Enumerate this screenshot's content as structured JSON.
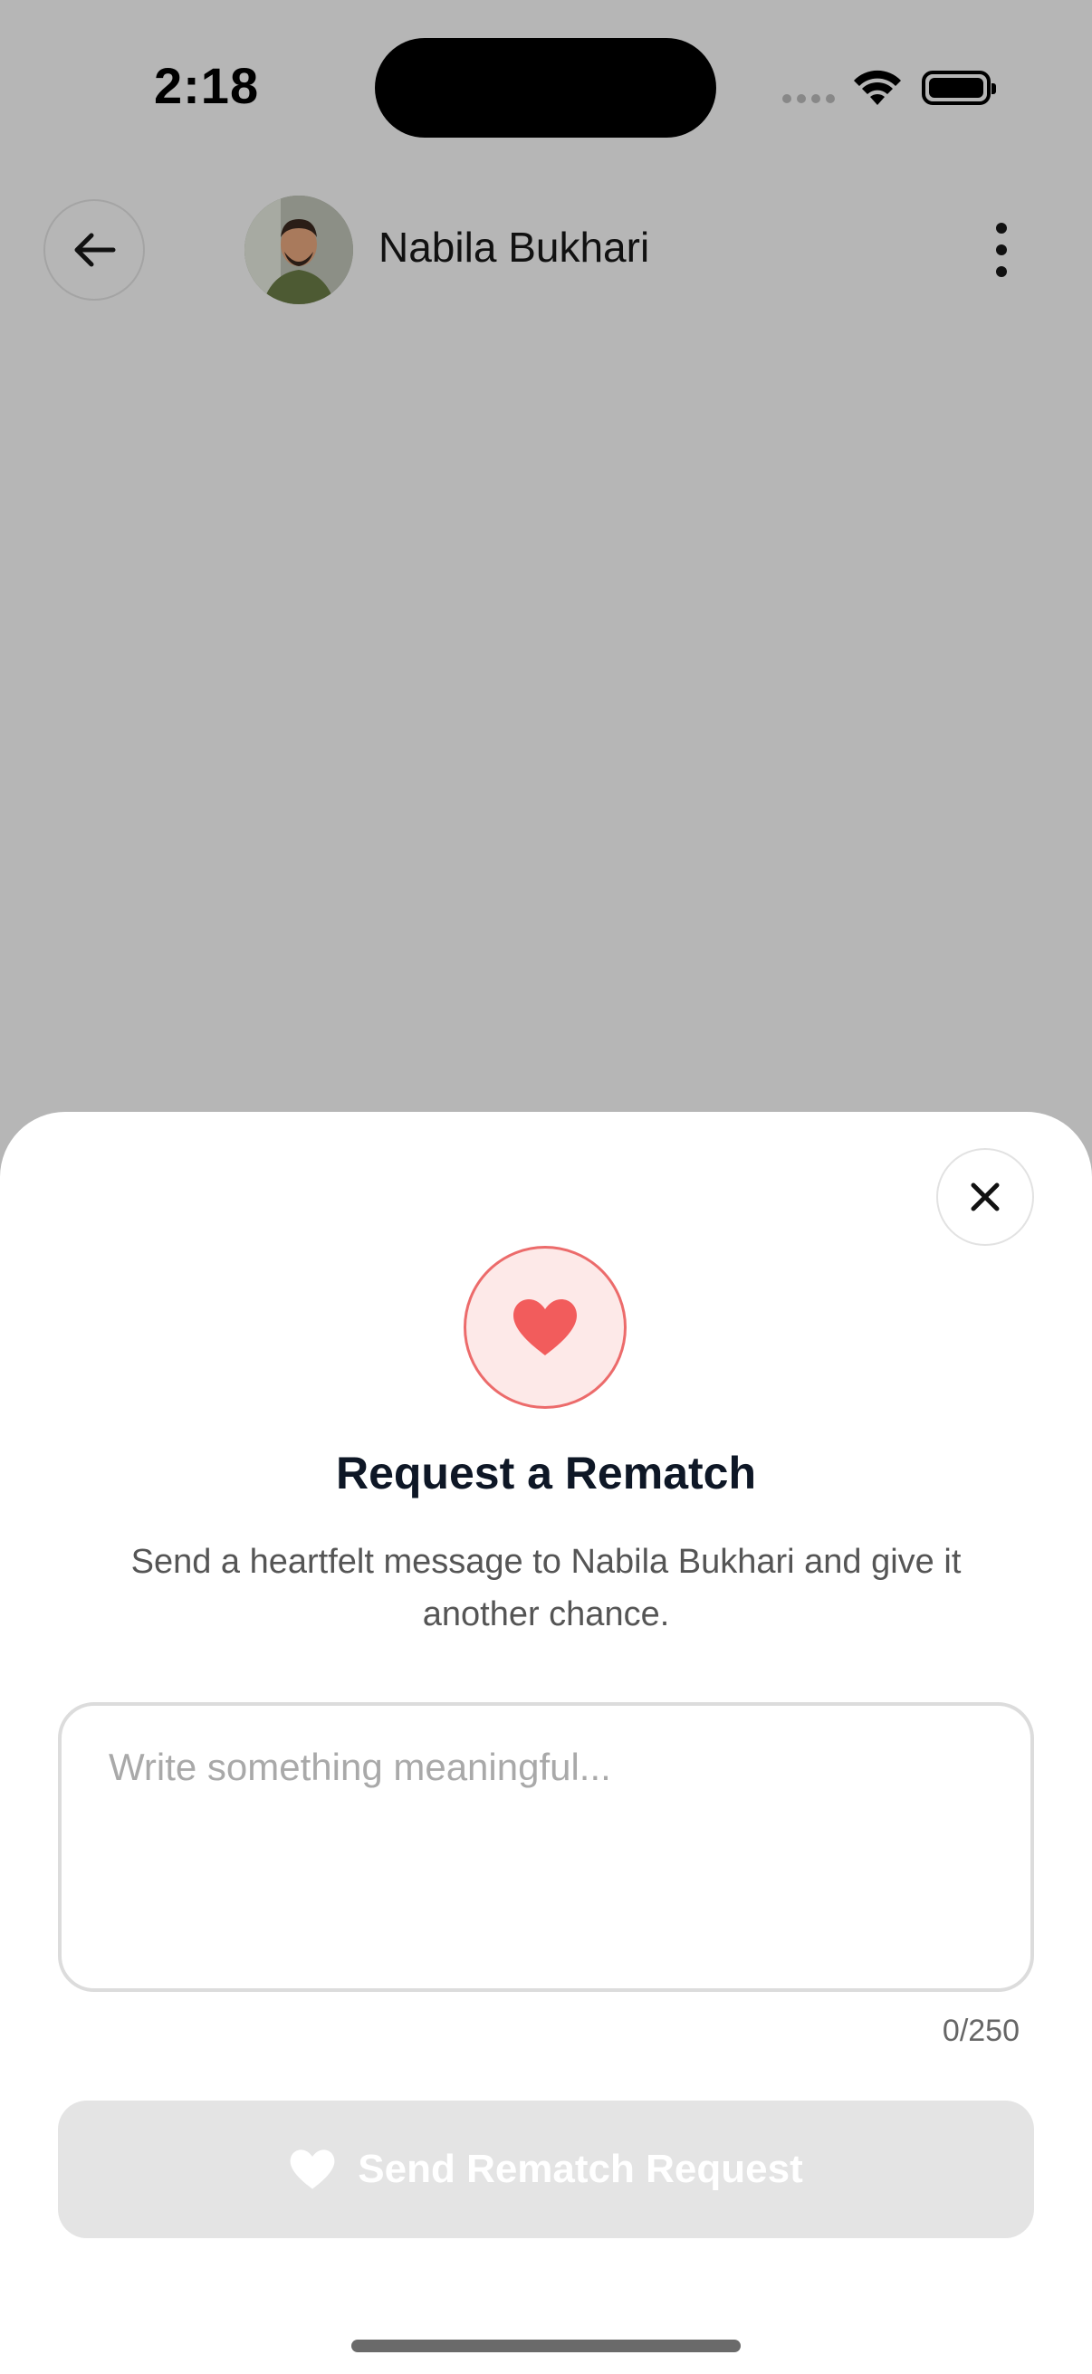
{
  "status_bar": {
    "time": "2:18"
  },
  "header": {
    "contact_name": "Nabila Bukhari",
    "back_icon": "arrow-left-icon",
    "more_icon": "more-vertical-icon"
  },
  "rematch_sheet": {
    "title": "Request a Rematch",
    "subtitle": "Send a heartfelt message to Nabila Bukhari and give it another chance.",
    "message_placeholder": "Write something meaningful...",
    "message_value": "",
    "char_counter": "0/250",
    "send_button_label": "Send Rematch Request",
    "send_button_enabled": false,
    "close_icon": "close-icon",
    "heart_icon": "heart-icon"
  },
  "colors": {
    "overlay_background": "#b6b6b6",
    "accent_heart": "#f25c5c",
    "heart_circle_fill": "#fde9e8",
    "disabled_button": "#e4e4e4",
    "title_text": "#0e1726"
  }
}
